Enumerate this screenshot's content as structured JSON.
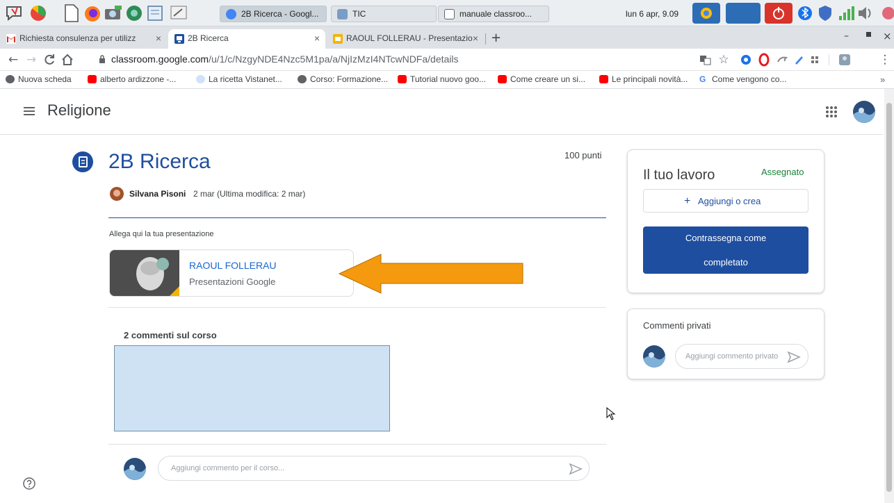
{
  "taskbar": {
    "windows": [
      {
        "label": "2B Ricerca - Googl..."
      },
      {
        "label": "TIC"
      },
      {
        "label": "manuale classroo..."
      }
    ],
    "clock": "lun 6 apr, 9.09"
  },
  "browser": {
    "tabs": [
      {
        "label": "Richiesta consulenza per utilizz"
      },
      {
        "label": "2B Ricerca"
      },
      {
        "label": "RAOUL FOLLERAU - Presentazio"
      }
    ],
    "url_host": "classroom.google.com",
    "url_path": "/u/1/c/NzgyNDE4Nzc5M1pa/a/NjIzMzI4NTcwNDFa/details",
    "bookmarks": [
      {
        "label": "Nuova scheda"
      },
      {
        "label": "alberto ardizzone -..."
      },
      {
        "label": "La ricetta Vistanet..."
      },
      {
        "label": "Corso: Formazione..."
      },
      {
        "label": "Tutorial nuovo goo..."
      },
      {
        "label": "Come creare un si..."
      },
      {
        "label": "Le principali novità..."
      },
      {
        "label": "Come vengono co..."
      }
    ]
  },
  "app": {
    "course_title": "Religione"
  },
  "assignment": {
    "title": "2B Ricerca",
    "points": "100 punti",
    "author": "Silvana Pisoni",
    "date": "2 mar (Ultima modifica: 2 mar)",
    "instructions": "Allega qui la tua presentazione",
    "attachment": {
      "title": "RAOUL FOLLERAU",
      "type": "Presentazioni Google"
    },
    "class_comments_heading": "2 commenti sul corso",
    "class_comment_placeholder": "Aggiungi commento per il corso..."
  },
  "your_work": {
    "title": "Il tuo lavoro",
    "status": "Assegnato",
    "add_button": "Aggiungi o crea",
    "mark_done_line1": "Contrassegna come",
    "mark_done_line2": "completato"
  },
  "private_comments": {
    "title": "Commenti privati",
    "placeholder": "Aggiungi commento privato"
  },
  "colors": {
    "accent": "#1e4e9f",
    "status_green": "#188038",
    "link_blue": "#1967d2",
    "arrow": "#f59a0e"
  }
}
